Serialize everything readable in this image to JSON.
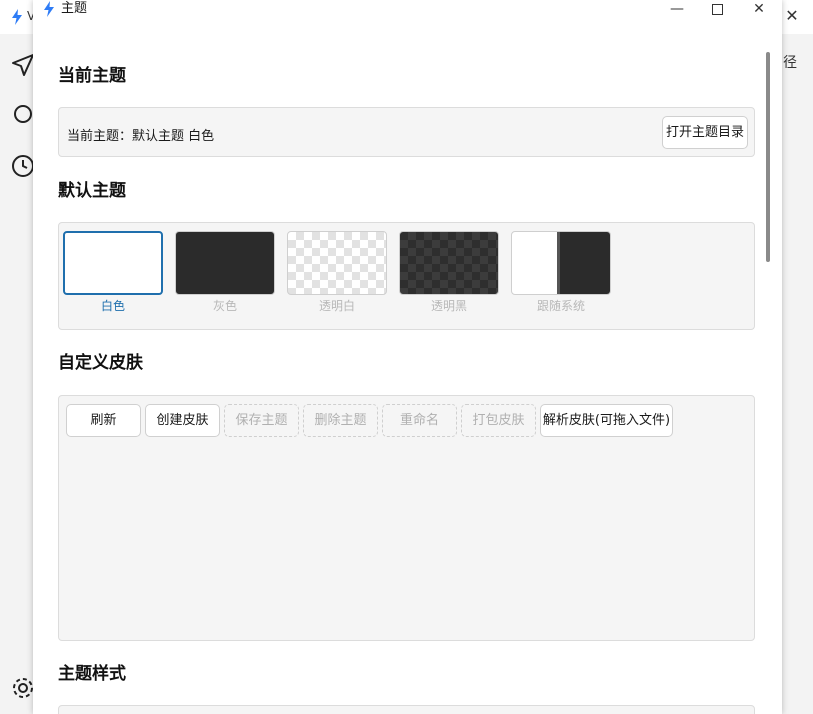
{
  "background_window": {
    "title_fragment": "V",
    "right_fragment": "径",
    "close_glyph": "✕"
  },
  "dialog": {
    "title": "主题",
    "controls": {
      "minimize": "—",
      "close": "✕"
    }
  },
  "current_theme": {
    "heading": "当前主题",
    "label": "当前主题：默认主题 白色",
    "open_dir_button": "打开主题目录"
  },
  "default_themes": {
    "heading": "默认主题",
    "items": [
      {
        "label": "白色",
        "selected": true
      },
      {
        "label": "灰色",
        "selected": false
      },
      {
        "label": "透明白",
        "selected": false
      },
      {
        "label": "透明黑",
        "selected": false
      },
      {
        "label": "跟随系统",
        "selected": false
      }
    ]
  },
  "custom_skin": {
    "heading": "自定义皮肤",
    "buttons": [
      {
        "label": "刷新",
        "enabled": true
      },
      {
        "label": "创建皮肤",
        "enabled": true
      },
      {
        "label": "保存主题",
        "enabled": false
      },
      {
        "label": "删除主题",
        "enabled": false
      },
      {
        "label": "重命名",
        "enabled": false
      },
      {
        "label": "打包皮肤",
        "enabled": false
      },
      {
        "label": "解析皮肤(可拖入文件)",
        "enabled": true
      }
    ]
  },
  "theme_style": {
    "heading": "主题样式"
  },
  "colors": {
    "accent": "#1f6fad",
    "panel_bg": "#f5f5f5",
    "dark_swatch": "#2b2b2b",
    "disabled_text": "#b0b0b0"
  },
  "icons": {
    "app": "lightning-bolt-icon",
    "sidebar": [
      "send-icon",
      "search-icon",
      "clock-icon",
      "gear-icon"
    ]
  }
}
